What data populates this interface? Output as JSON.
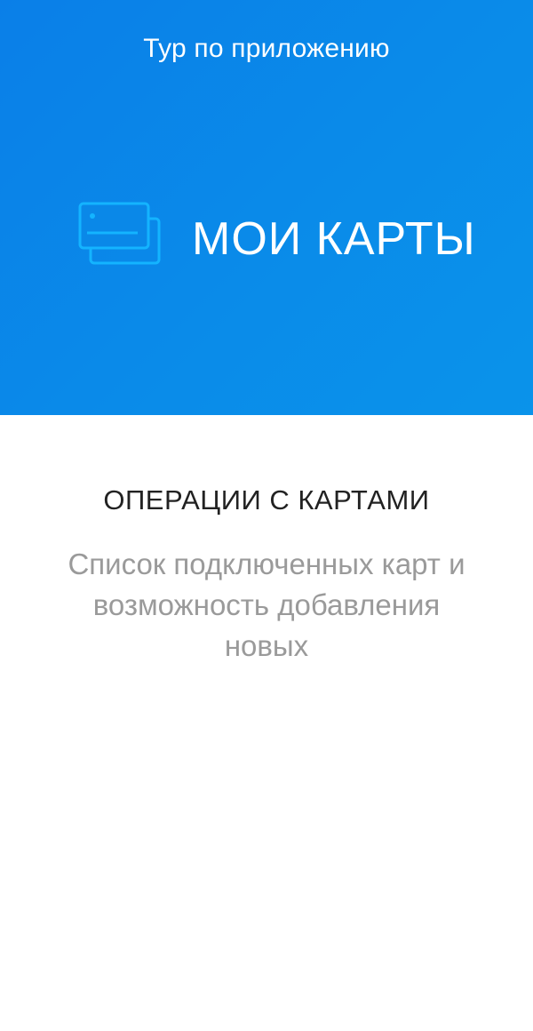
{
  "header": {
    "title": "Тур по приложению"
  },
  "hero": {
    "icon": "cards-icon",
    "title": "МОИ КАРТЫ",
    "background_color": "#0a8be9",
    "icon_color": "#14b4ff"
  },
  "feature": {
    "heading": "ОПЕРАЦИИ С КАРТАМИ",
    "description": "Список подключенных карт и возможность добавления новых"
  }
}
